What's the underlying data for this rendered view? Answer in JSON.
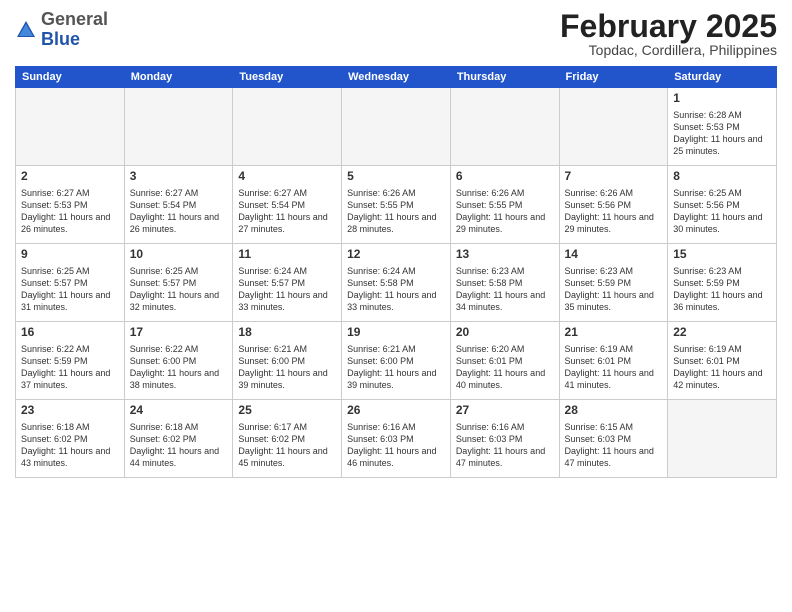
{
  "logo": {
    "general": "General",
    "blue": "Blue"
  },
  "title": "February 2025",
  "location": "Topdac, Cordillera, Philippines",
  "days_of_week": [
    "Sunday",
    "Monday",
    "Tuesday",
    "Wednesday",
    "Thursday",
    "Friday",
    "Saturday"
  ],
  "weeks": [
    [
      {
        "day": "",
        "info": ""
      },
      {
        "day": "",
        "info": ""
      },
      {
        "day": "",
        "info": ""
      },
      {
        "day": "",
        "info": ""
      },
      {
        "day": "",
        "info": ""
      },
      {
        "day": "",
        "info": ""
      },
      {
        "day": "1",
        "info": "Sunrise: 6:28 AM\nSunset: 5:53 PM\nDaylight: 11 hours and 25 minutes."
      }
    ],
    [
      {
        "day": "2",
        "info": "Sunrise: 6:27 AM\nSunset: 5:53 PM\nDaylight: 11 hours and 26 minutes."
      },
      {
        "day": "3",
        "info": "Sunrise: 6:27 AM\nSunset: 5:54 PM\nDaylight: 11 hours and 26 minutes."
      },
      {
        "day": "4",
        "info": "Sunrise: 6:27 AM\nSunset: 5:54 PM\nDaylight: 11 hours and 27 minutes."
      },
      {
        "day": "5",
        "info": "Sunrise: 6:26 AM\nSunset: 5:55 PM\nDaylight: 11 hours and 28 minutes."
      },
      {
        "day": "6",
        "info": "Sunrise: 6:26 AM\nSunset: 5:55 PM\nDaylight: 11 hours and 29 minutes."
      },
      {
        "day": "7",
        "info": "Sunrise: 6:26 AM\nSunset: 5:56 PM\nDaylight: 11 hours and 29 minutes."
      },
      {
        "day": "8",
        "info": "Sunrise: 6:25 AM\nSunset: 5:56 PM\nDaylight: 11 hours and 30 minutes."
      }
    ],
    [
      {
        "day": "9",
        "info": "Sunrise: 6:25 AM\nSunset: 5:57 PM\nDaylight: 11 hours and 31 minutes."
      },
      {
        "day": "10",
        "info": "Sunrise: 6:25 AM\nSunset: 5:57 PM\nDaylight: 11 hours and 32 minutes."
      },
      {
        "day": "11",
        "info": "Sunrise: 6:24 AM\nSunset: 5:57 PM\nDaylight: 11 hours and 33 minutes."
      },
      {
        "day": "12",
        "info": "Sunrise: 6:24 AM\nSunset: 5:58 PM\nDaylight: 11 hours and 33 minutes."
      },
      {
        "day": "13",
        "info": "Sunrise: 6:23 AM\nSunset: 5:58 PM\nDaylight: 11 hours and 34 minutes."
      },
      {
        "day": "14",
        "info": "Sunrise: 6:23 AM\nSunset: 5:59 PM\nDaylight: 11 hours and 35 minutes."
      },
      {
        "day": "15",
        "info": "Sunrise: 6:23 AM\nSunset: 5:59 PM\nDaylight: 11 hours and 36 minutes."
      }
    ],
    [
      {
        "day": "16",
        "info": "Sunrise: 6:22 AM\nSunset: 5:59 PM\nDaylight: 11 hours and 37 minutes."
      },
      {
        "day": "17",
        "info": "Sunrise: 6:22 AM\nSunset: 6:00 PM\nDaylight: 11 hours and 38 minutes."
      },
      {
        "day": "18",
        "info": "Sunrise: 6:21 AM\nSunset: 6:00 PM\nDaylight: 11 hours and 39 minutes."
      },
      {
        "day": "19",
        "info": "Sunrise: 6:21 AM\nSunset: 6:00 PM\nDaylight: 11 hours and 39 minutes."
      },
      {
        "day": "20",
        "info": "Sunrise: 6:20 AM\nSunset: 6:01 PM\nDaylight: 11 hours and 40 minutes."
      },
      {
        "day": "21",
        "info": "Sunrise: 6:19 AM\nSunset: 6:01 PM\nDaylight: 11 hours and 41 minutes."
      },
      {
        "day": "22",
        "info": "Sunrise: 6:19 AM\nSunset: 6:01 PM\nDaylight: 11 hours and 42 minutes."
      }
    ],
    [
      {
        "day": "23",
        "info": "Sunrise: 6:18 AM\nSunset: 6:02 PM\nDaylight: 11 hours and 43 minutes."
      },
      {
        "day": "24",
        "info": "Sunrise: 6:18 AM\nSunset: 6:02 PM\nDaylight: 11 hours and 44 minutes."
      },
      {
        "day": "25",
        "info": "Sunrise: 6:17 AM\nSunset: 6:02 PM\nDaylight: 11 hours and 45 minutes."
      },
      {
        "day": "26",
        "info": "Sunrise: 6:16 AM\nSunset: 6:03 PM\nDaylight: 11 hours and 46 minutes."
      },
      {
        "day": "27",
        "info": "Sunrise: 6:16 AM\nSunset: 6:03 PM\nDaylight: 11 hours and 47 minutes."
      },
      {
        "day": "28",
        "info": "Sunrise: 6:15 AM\nSunset: 6:03 PM\nDaylight: 11 hours and 47 minutes."
      },
      {
        "day": "",
        "info": ""
      }
    ]
  ]
}
